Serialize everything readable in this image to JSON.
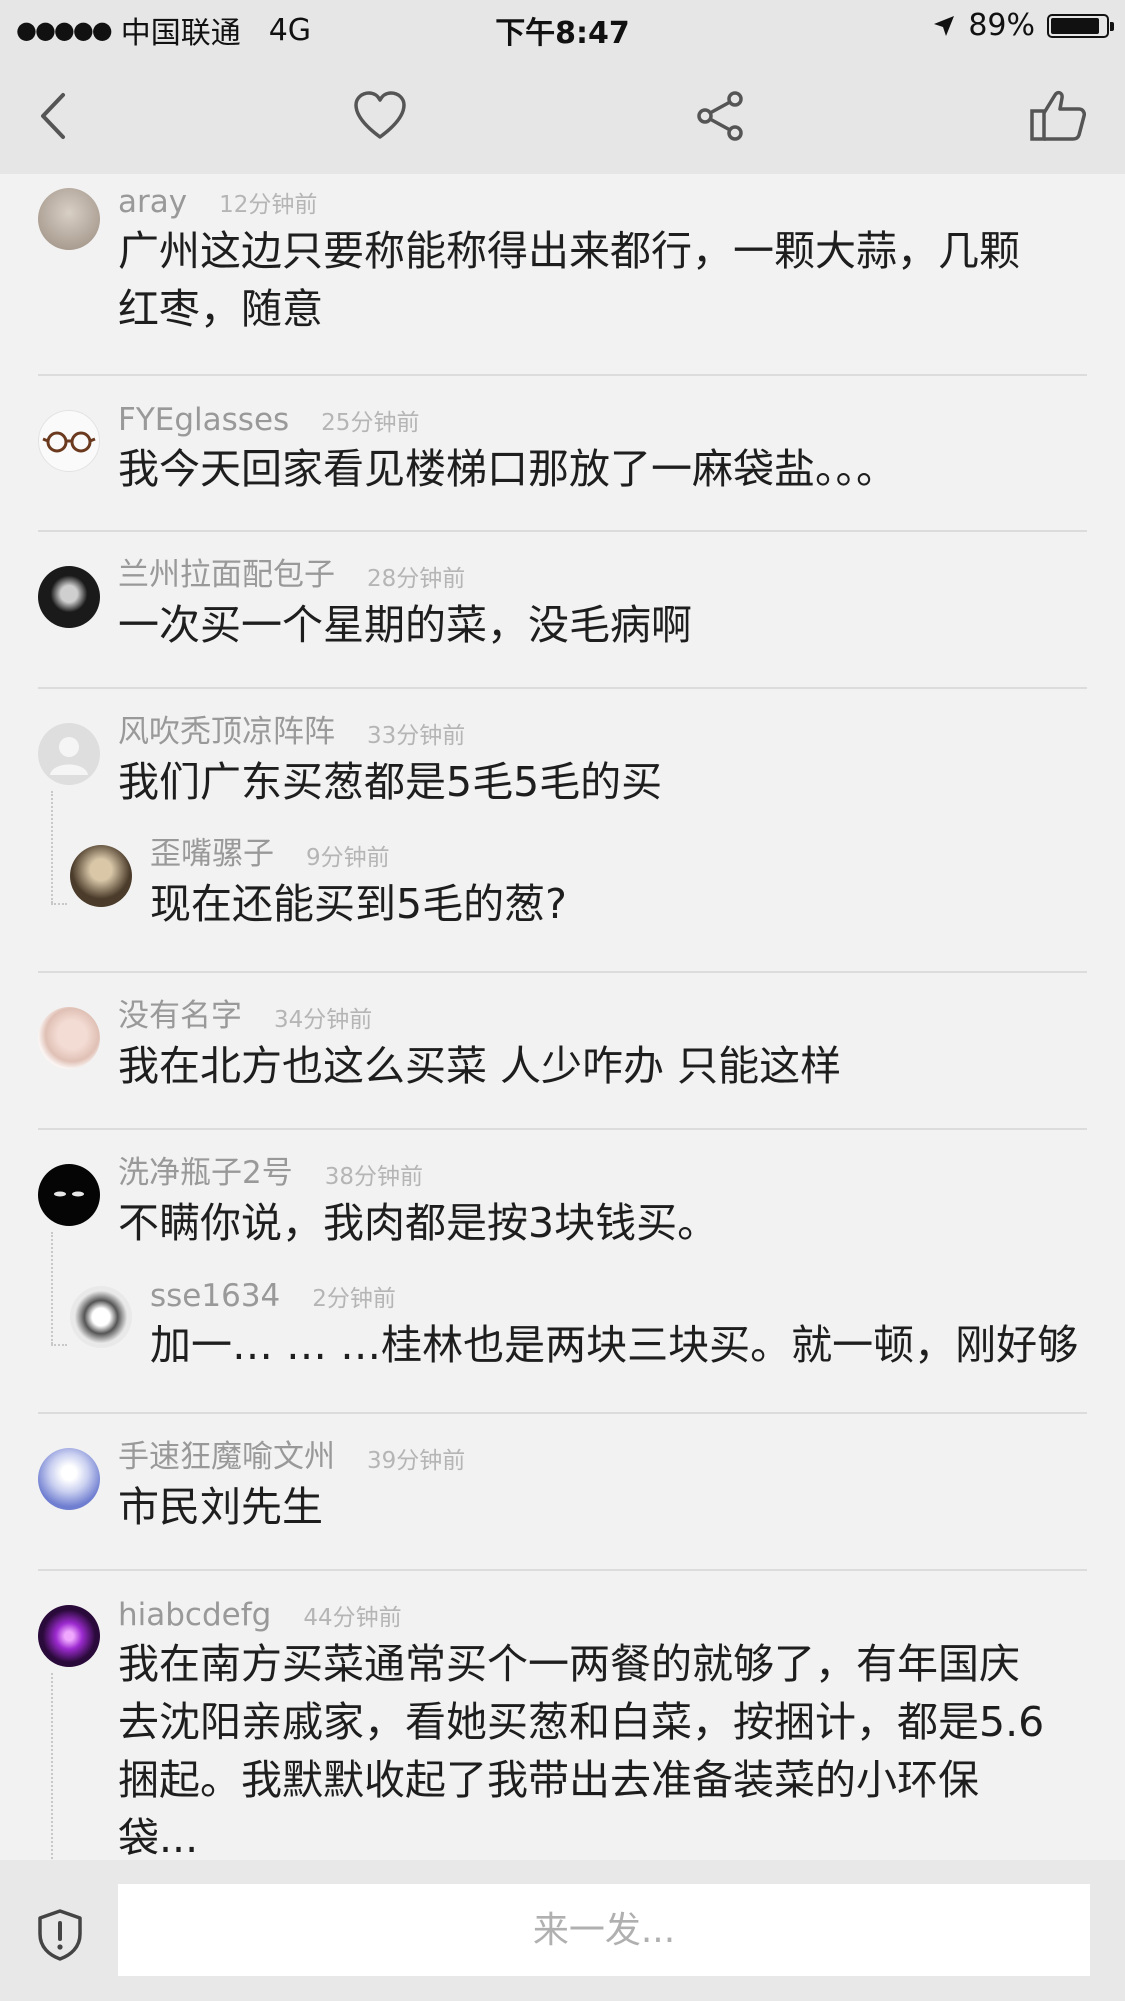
{
  "status_bar": {
    "signal_dots": "●●●●●",
    "carrier": "中国联通",
    "network": "4G",
    "time": "下午8:47",
    "battery_percent": "89%",
    "battery_level": 0.89,
    "location_icon": "location-arrow-icon"
  },
  "nav": {
    "back_icon": "chevron-left-icon",
    "favorite_icon": "heart-icon",
    "share_icon": "share-icon",
    "like_icon": "thumbs-up-icon"
  },
  "comments": [
    {
      "user": "aray",
      "time": "12分钟前",
      "text_lines": [
        "广州这边只要称能称得出来都行，一颗大蒜，几颗",
        "红枣，随意"
      ]
    },
    {
      "user": "FYEglasses",
      "time": "25分钟前",
      "text_lines": [
        "我今天回家看见楼梯口那放了一麻袋盐。。。"
      ]
    },
    {
      "user": "兰州拉面配包子",
      "time": "28分钟前",
      "text_lines": [
        "一次买一个星期的菜，没毛病啊"
      ]
    },
    {
      "user": "风吹秃顶凉阵阵",
      "time": "33分钟前",
      "text_lines": [
        "我们广东买葱都是5毛5毛的买"
      ],
      "reply": {
        "user": "歪嘴骡子",
        "time": "9分钟前",
        "text_lines": [
          "现在还能买到5毛的葱?"
        ]
      }
    },
    {
      "user": "没有名字",
      "time": "34分钟前",
      "text_lines": [
        "我在北方也这么买菜 人少咋办 只能这样"
      ]
    },
    {
      "user": "洗净瓶子2号",
      "time": "38分钟前",
      "text_lines": [
        "不瞒你说，我肉都是按3块钱买。"
      ],
      "reply": {
        "user": "sse1634",
        "time": "2分钟前",
        "text_lines": [
          "加一… … …桂林也是两块三块买。就一顿，刚好够"
        ]
      }
    },
    {
      "user": "手速狂魔喻文州",
      "time": "39分钟前",
      "text_lines": [
        "市民刘先生"
      ]
    },
    {
      "user": "hiabcdefg",
      "time": "44分钟前",
      "text_lines": [
        "我在南方买菜通常买个一两餐的就够了，有年国庆",
        "去沈阳亲戚家，看她买葱和白菜，按捆计，都是5.6",
        "捆起。我默默收起了我带出去准备装菜的小环保",
        "袋..."
      ]
    }
  ],
  "bottom_bar": {
    "input_placeholder": "来一发...",
    "shield_icon": "shield-icon"
  },
  "colors": {
    "bar_background": "#e6e6e6",
    "page_background": "#f2f2f2",
    "username": "#999999",
    "timestamp": "#b5b5b5"
  }
}
